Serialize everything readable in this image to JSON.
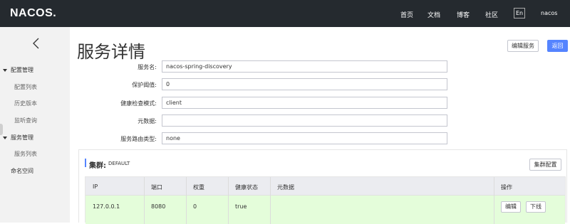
{
  "topbar": {
    "logo": "NACOS.",
    "nav": [
      "首页",
      "文档",
      "博客",
      "社区"
    ],
    "lang": "En",
    "user": "nacos"
  },
  "sidebar": {
    "groups": [
      {
        "label": "配置管理",
        "items": [
          "配置列表",
          "历史版本",
          "监听查询"
        ]
      },
      {
        "label": "服务管理",
        "items": [
          "服务列表"
        ]
      }
    ],
    "namespace": "命名空间"
  },
  "page": {
    "title": "服务详情",
    "edit_service_label": "编辑服务",
    "back_label": "返回"
  },
  "form": {
    "service_name": {
      "label": "服务名:",
      "value": "nacos-spring-discovery"
    },
    "protect_threshold": {
      "label": "保护阈值:",
      "value": "0"
    },
    "health_check_mode": {
      "label": "健康检查模式:",
      "value": "client"
    },
    "metadata": {
      "label": "元数据:",
      "value": ""
    },
    "route_type": {
      "label": "服务路由类型:",
      "value": "none"
    }
  },
  "cluster": {
    "title": "集群:",
    "name": "DEFAULT",
    "config_label": "集群配置",
    "columns": [
      "IP",
      "端口",
      "权重",
      "健康状态",
      "元数据",
      "操作"
    ],
    "rows": [
      {
        "ip": "127.0.0.1",
        "port": "8080",
        "weight": "0",
        "healthy": "true",
        "metadata": "",
        "edit_label": "编辑",
        "offline_label": "下线"
      }
    ]
  },
  "colors": {
    "primary": "#5584ff",
    "topbar": "#252a2f",
    "row_healthy": "#e4fdda"
  }
}
